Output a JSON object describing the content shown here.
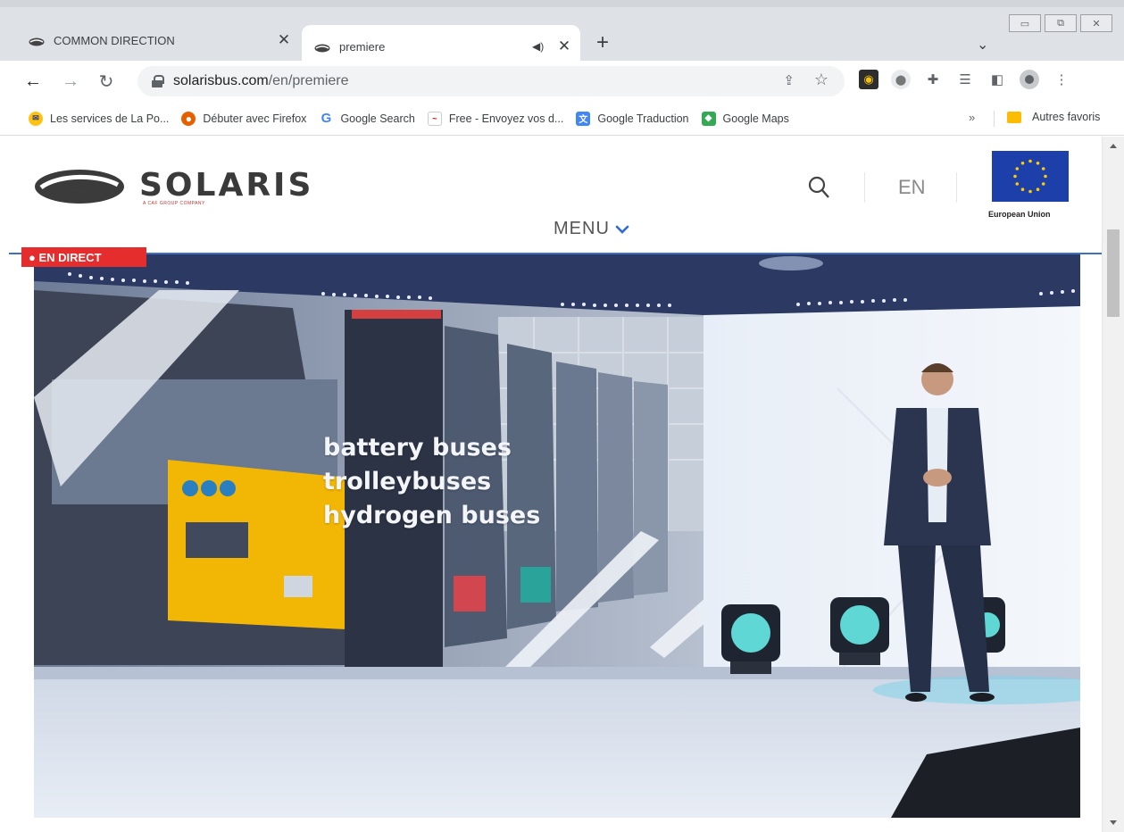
{
  "browser": {
    "tabs": [
      {
        "title": "COMMON DIRECTION",
        "active": false
      },
      {
        "title": "premiere",
        "active": true
      }
    ],
    "new_tab_label": "+",
    "url": {
      "domain": "solarisbus.com",
      "path": "/en/premiere"
    },
    "bookmarks": [
      {
        "label": "Les services de La Po...",
        "icon": "la-poste-icon"
      },
      {
        "label": "Débuter avec Firefox",
        "icon": "firefox-icon"
      },
      {
        "label": "Google Search",
        "icon": "google-icon"
      },
      {
        "label": "Free - Envoyez vos d...",
        "icon": "free-icon"
      },
      {
        "label": "Google Traduction",
        "icon": "google-translate-icon"
      },
      {
        "label": "Google Maps",
        "icon": "google-maps-icon"
      }
    ],
    "bookmarks_more": "»",
    "other_bookmarks": "Autres favoris"
  },
  "site": {
    "logo_text": "SOLARIS",
    "logo_subtitle": "A CAF GROUP COMPANY",
    "language": "EN",
    "eu_label": "European Union",
    "menu_label": "MENU",
    "live_badge": "● EN DIRECT",
    "hero_lines": [
      "battery buses",
      "trolleybuses",
      "hydrogen buses"
    ]
  },
  "colors": {
    "accent_blue": "#3d6fc2",
    "live_red": "#e52d2d",
    "eu_blue": "#1c3faa",
    "eu_star": "#ffcc00",
    "bus_yellow": "#f2b705"
  }
}
